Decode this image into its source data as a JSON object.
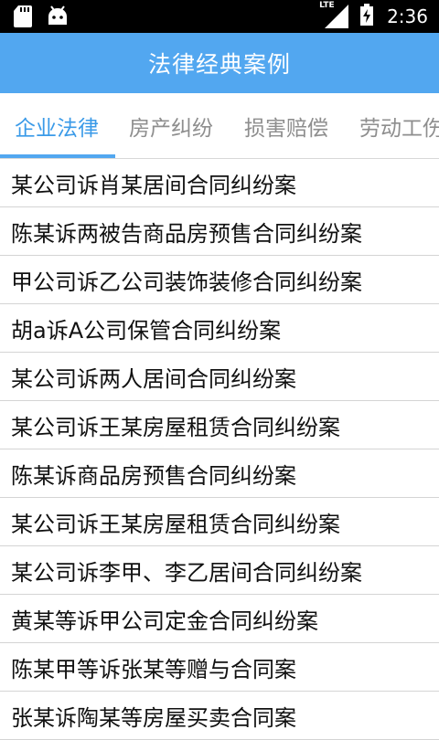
{
  "status_bar": {
    "time": "2:36",
    "network_label": "LTE",
    "icons": [
      "sd-card-icon",
      "android-icon",
      "lte-signal-icon",
      "battery-charging-icon"
    ]
  },
  "app_bar": {
    "title": "法律经典案例"
  },
  "tabs": [
    {
      "label": "企业法律",
      "active": true
    },
    {
      "label": "房产纠纷",
      "active": false
    },
    {
      "label": "损害赔偿",
      "active": false
    },
    {
      "label": "劳动工伤",
      "active": false
    }
  ],
  "cases": [
    "某公司诉肖某居间合同纠纷案",
    "陈某诉两被告商品房预售合同纠纷案",
    "甲公司诉乙公司装饰装修合同纠纷案",
    "胡a诉A公司保管合同纠纷案",
    "某公司诉两人居间合同纠纷案",
    "某公司诉王某房屋租赁合同纠纷案",
    "陈某诉商品房预售合同纠纷案",
    "某公司诉王某房屋租赁合同纠纷案",
    "某公司诉李甲、李乙居间合同纠纷案",
    "黄某等诉甲公司定金合同纠纷案",
    "陈某甲等诉张某等赠与合同案",
    "张某诉陶某等房屋买卖合同案"
  ],
  "colors": {
    "primary": "#52a7f0",
    "tab_active": "#3a9ae8",
    "tab_inactive": "#8e8e8e",
    "status_bar": "#000000"
  }
}
